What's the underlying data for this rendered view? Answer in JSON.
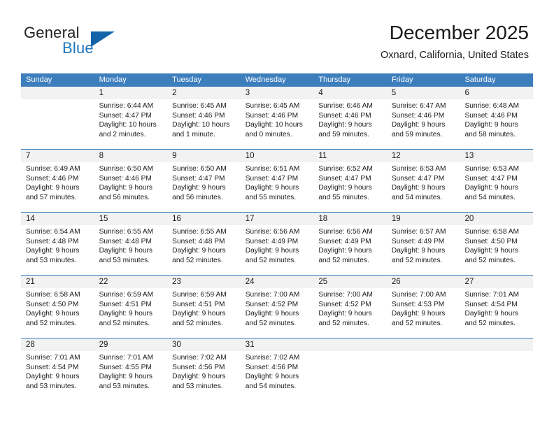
{
  "brand": {
    "name_part1": "General",
    "name_part2": "Blue",
    "logo_icon": "triangle-logo-icon",
    "accent_color": "#1263a8",
    "text_color": "#1f76bd"
  },
  "header": {
    "title": "December 2025",
    "subtitle": "Oxnard, California, United States"
  },
  "calendar": {
    "header_bg": "#3d7ebd",
    "daynum_bg": "#f2f2f2",
    "weekdays": [
      "Sunday",
      "Monday",
      "Tuesday",
      "Wednesday",
      "Thursday",
      "Friday",
      "Saturday"
    ],
    "weeks": [
      [
        {
          "day": "",
          "lines": []
        },
        {
          "day": "1",
          "lines": [
            "Sunrise: 6:44 AM",
            "Sunset: 4:47 PM",
            "Daylight: 10 hours",
            "and 2 minutes."
          ]
        },
        {
          "day": "2",
          "lines": [
            "Sunrise: 6:45 AM",
            "Sunset: 4:46 PM",
            "Daylight: 10 hours",
            "and 1 minute."
          ]
        },
        {
          "day": "3",
          "lines": [
            "Sunrise: 6:45 AM",
            "Sunset: 4:46 PM",
            "Daylight: 10 hours",
            "and 0 minutes."
          ]
        },
        {
          "day": "4",
          "lines": [
            "Sunrise: 6:46 AM",
            "Sunset: 4:46 PM",
            "Daylight: 9 hours",
            "and 59 minutes."
          ]
        },
        {
          "day": "5",
          "lines": [
            "Sunrise: 6:47 AM",
            "Sunset: 4:46 PM",
            "Daylight: 9 hours",
            "and 59 minutes."
          ]
        },
        {
          "day": "6",
          "lines": [
            "Sunrise: 6:48 AM",
            "Sunset: 4:46 PM",
            "Daylight: 9 hours",
            "and 58 minutes."
          ]
        }
      ],
      [
        {
          "day": "7",
          "lines": [
            "Sunrise: 6:49 AM",
            "Sunset: 4:46 PM",
            "Daylight: 9 hours",
            "and 57 minutes."
          ]
        },
        {
          "day": "8",
          "lines": [
            "Sunrise: 6:50 AM",
            "Sunset: 4:46 PM",
            "Daylight: 9 hours",
            "and 56 minutes."
          ]
        },
        {
          "day": "9",
          "lines": [
            "Sunrise: 6:50 AM",
            "Sunset: 4:47 PM",
            "Daylight: 9 hours",
            "and 56 minutes."
          ]
        },
        {
          "day": "10",
          "lines": [
            "Sunrise: 6:51 AM",
            "Sunset: 4:47 PM",
            "Daylight: 9 hours",
            "and 55 minutes."
          ]
        },
        {
          "day": "11",
          "lines": [
            "Sunrise: 6:52 AM",
            "Sunset: 4:47 PM",
            "Daylight: 9 hours",
            "and 55 minutes."
          ]
        },
        {
          "day": "12",
          "lines": [
            "Sunrise: 6:53 AM",
            "Sunset: 4:47 PM",
            "Daylight: 9 hours",
            "and 54 minutes."
          ]
        },
        {
          "day": "13",
          "lines": [
            "Sunrise: 6:53 AM",
            "Sunset: 4:47 PM",
            "Daylight: 9 hours",
            "and 54 minutes."
          ]
        }
      ],
      [
        {
          "day": "14",
          "lines": [
            "Sunrise: 6:54 AM",
            "Sunset: 4:48 PM",
            "Daylight: 9 hours",
            "and 53 minutes."
          ]
        },
        {
          "day": "15",
          "lines": [
            "Sunrise: 6:55 AM",
            "Sunset: 4:48 PM",
            "Daylight: 9 hours",
            "and 53 minutes."
          ]
        },
        {
          "day": "16",
          "lines": [
            "Sunrise: 6:55 AM",
            "Sunset: 4:48 PM",
            "Daylight: 9 hours",
            "and 52 minutes."
          ]
        },
        {
          "day": "17",
          "lines": [
            "Sunrise: 6:56 AM",
            "Sunset: 4:49 PM",
            "Daylight: 9 hours",
            "and 52 minutes."
          ]
        },
        {
          "day": "18",
          "lines": [
            "Sunrise: 6:56 AM",
            "Sunset: 4:49 PM",
            "Daylight: 9 hours",
            "and 52 minutes."
          ]
        },
        {
          "day": "19",
          "lines": [
            "Sunrise: 6:57 AM",
            "Sunset: 4:49 PM",
            "Daylight: 9 hours",
            "and 52 minutes."
          ]
        },
        {
          "day": "20",
          "lines": [
            "Sunrise: 6:58 AM",
            "Sunset: 4:50 PM",
            "Daylight: 9 hours",
            "and 52 minutes."
          ]
        }
      ],
      [
        {
          "day": "21",
          "lines": [
            "Sunrise: 6:58 AM",
            "Sunset: 4:50 PM",
            "Daylight: 9 hours",
            "and 52 minutes."
          ]
        },
        {
          "day": "22",
          "lines": [
            "Sunrise: 6:59 AM",
            "Sunset: 4:51 PM",
            "Daylight: 9 hours",
            "and 52 minutes."
          ]
        },
        {
          "day": "23",
          "lines": [
            "Sunrise: 6:59 AM",
            "Sunset: 4:51 PM",
            "Daylight: 9 hours",
            "and 52 minutes."
          ]
        },
        {
          "day": "24",
          "lines": [
            "Sunrise: 7:00 AM",
            "Sunset: 4:52 PM",
            "Daylight: 9 hours",
            "and 52 minutes."
          ]
        },
        {
          "day": "25",
          "lines": [
            "Sunrise: 7:00 AM",
            "Sunset: 4:52 PM",
            "Daylight: 9 hours",
            "and 52 minutes."
          ]
        },
        {
          "day": "26",
          "lines": [
            "Sunrise: 7:00 AM",
            "Sunset: 4:53 PM",
            "Daylight: 9 hours",
            "and 52 minutes."
          ]
        },
        {
          "day": "27",
          "lines": [
            "Sunrise: 7:01 AM",
            "Sunset: 4:54 PM",
            "Daylight: 9 hours",
            "and 52 minutes."
          ]
        }
      ],
      [
        {
          "day": "28",
          "lines": [
            "Sunrise: 7:01 AM",
            "Sunset: 4:54 PM",
            "Daylight: 9 hours",
            "and 53 minutes."
          ]
        },
        {
          "day": "29",
          "lines": [
            "Sunrise: 7:01 AM",
            "Sunset: 4:55 PM",
            "Daylight: 9 hours",
            "and 53 minutes."
          ]
        },
        {
          "day": "30",
          "lines": [
            "Sunrise: 7:02 AM",
            "Sunset: 4:56 PM",
            "Daylight: 9 hours",
            "and 53 minutes."
          ]
        },
        {
          "day": "31",
          "lines": [
            "Sunrise: 7:02 AM",
            "Sunset: 4:56 PM",
            "Daylight: 9 hours",
            "and 54 minutes."
          ]
        },
        {
          "day": "",
          "lines": []
        },
        {
          "day": "",
          "lines": []
        },
        {
          "day": "",
          "lines": []
        }
      ]
    ]
  }
}
